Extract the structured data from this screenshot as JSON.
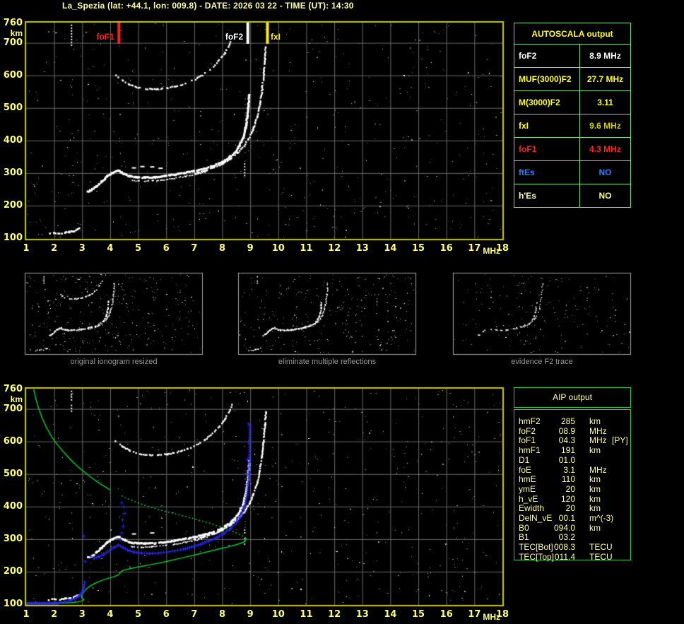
{
  "title": "La_Spezia (lat: +44.1, lon: 009.8) - DATE: 2026 03 22 - TIME (UT): 14:30",
  "colors": {
    "background": "#000000",
    "title_text": "#ffffa8",
    "axis_text": "#ffff7a",
    "plot_border": "#c9c900",
    "grid": "#6a6a6a",
    "echo_white": "#ffffff",
    "profile_green": "#00cc33",
    "restored_blue": "#2a2aff",
    "autoscala_border": "#7fe07f",
    "aip_border": "#2ecc44",
    "aip_text": "#ffffa2",
    "caption_gray": "#9a9a9a",
    "fof1_red": "#ff2020",
    "fof2_white": "#ffffff",
    "fxi_yellow": "#ffee00"
  },
  "ionogram": {
    "x_unit": "MHz",
    "y_unit": "km",
    "x_ticks": [
      "1",
      "2",
      "3",
      "4",
      "5",
      "6",
      "7",
      "8",
      "9",
      "10",
      "11",
      "12",
      "13",
      "14",
      "15",
      "16",
      "17",
      "18"
    ],
    "x_values": [
      1,
      2,
      3,
      4,
      5,
      6,
      7,
      8,
      9,
      10,
      11,
      12,
      13,
      14,
      15,
      16,
      17,
      18
    ],
    "y_ticks": [
      "760",
      "700",
      "600",
      "500",
      "400",
      "300",
      "200",
      "100"
    ],
    "y_values": [
      760,
      700,
      600,
      500,
      400,
      300,
      200,
      100
    ],
    "x_range": [
      1,
      18
    ],
    "y_range": [
      100,
      760
    ],
    "markers": [
      {
        "label": "foF1",
        "f": 4.3,
        "color": "#ff2020",
        "side": "left"
      },
      {
        "label": "foF2",
        "f": 8.9,
        "color": "#ffffff",
        "side": "left"
      },
      {
        "label": "fxI",
        "f": 9.6,
        "color": "#ffee00",
        "side": "right"
      }
    ]
  },
  "autoscala_table": {
    "header": "AUTOSCALA output",
    "header_color": "#ffff21",
    "rows": [
      {
        "label": "foF2",
        "value": "8.9 MHz",
        "label_color": "#ffffff",
        "value_color": "#ffffff"
      },
      {
        "label": "MUF(3000)F2",
        "value": "27.7 MHz",
        "label_color": "#ffff21",
        "value_color": "#ffff21"
      },
      {
        "label": "M(3000)F2",
        "value": "3.11",
        "label_color": "#ffff21",
        "value_color": "#ffff21"
      },
      {
        "label": "fxI",
        "value": "9.6 MHz",
        "label_color": "#ffff10",
        "value_color": "#cfcf00"
      },
      {
        "label": "foF1",
        "value": "4.3 MHz",
        "label_color": "#ff2020",
        "value_color": "#ff2020"
      },
      {
        "label": "ftEs",
        "value": "NO",
        "label_color": "#2e7fff",
        "value_color": "#2e7fff"
      },
      {
        "label": "h'Es",
        "value": "NO",
        "label_color": "#ffffb4",
        "value_color": "#ffff8c"
      }
    ]
  },
  "thumbnails": [
    {
      "caption": "original ionogram resized"
    },
    {
      "caption": "eliminate multiple reflections"
    },
    {
      "caption": "evidence F2 trace"
    }
  ],
  "aip_table": {
    "header": "AIP output",
    "rows": [
      {
        "label": "hmF2",
        "value": "285",
        "unit": "km",
        "extra": ""
      },
      {
        "label": "foF2",
        "value": "08.9",
        "unit": "MHz",
        "extra": ""
      },
      {
        "label": "foF1",
        "value": "04.3",
        "unit": "MHz",
        "extra": "[PY]"
      },
      {
        "label": "hmF1",
        "value": "191",
        "unit": "km",
        "extra": ""
      },
      {
        "label": "D1",
        "value": "01.0",
        "unit": "",
        "extra": ""
      },
      {
        "label": "foE",
        "value": "3.1",
        "unit": "MHz",
        "extra": ""
      },
      {
        "label": "hmE",
        "value": "110",
        "unit": "km",
        "extra": ""
      },
      {
        "label": "ymE",
        "value": "20",
        "unit": "km",
        "extra": ""
      },
      {
        "label": "h_vE",
        "value": "120",
        "unit": "km",
        "extra": ""
      },
      {
        "label": "Ewidth",
        "value": "20",
        "unit": "km",
        "extra": ""
      },
      {
        "label": "DelN_vE",
        "value": "00.1",
        "unit": "m^(-3)",
        "extra": ""
      },
      {
        "label": "B0",
        "value": "094.0",
        "unit": "km",
        "extra": ""
      },
      {
        "label": "B1",
        "value": "03.2",
        "unit": "",
        "extra": ""
      },
      {
        "label": "TEC[Bot]",
        "value": "008.3",
        "unit": "TECU",
        "extra": ""
      },
      {
        "label": "TEC[Top]",
        "value": "011.4",
        "unit": "TECU",
        "extra": ""
      }
    ]
  },
  "traces": {
    "o_trace": [
      [
        3.2,
        243
      ],
      [
        3.32,
        247
      ],
      [
        3.5,
        258
      ],
      [
        3.7,
        273
      ],
      [
        3.9,
        290
      ],
      [
        4.1,
        301
      ],
      [
        4.3,
        307
      ],
      [
        4.5,
        297
      ],
      [
        4.7,
        290
      ],
      [
        4.95,
        287
      ],
      [
        5.25,
        286
      ],
      [
        5.6,
        287
      ],
      [
        5.95,
        291
      ],
      [
        6.3,
        295
      ],
      [
        6.65,
        300
      ],
      [
        7.0,
        306
      ],
      [
        7.35,
        313
      ],
      [
        7.7,
        322
      ],
      [
        8.0,
        333
      ],
      [
        8.25,
        347
      ],
      [
        8.45,
        363
      ],
      [
        8.62,
        384
      ],
      [
        8.75,
        409
      ],
      [
        8.84,
        440
      ],
      [
        8.9,
        475
      ],
      [
        8.94,
        510
      ],
      [
        8.97,
        540
      ]
    ],
    "o_lower": [
      [
        4.75,
        277
      ],
      [
        5.1,
        275
      ],
      [
        5.5,
        276
      ],
      [
        5.9,
        279
      ],
      [
        6.3,
        284
      ],
      [
        6.7,
        290
      ],
      [
        7.1,
        297
      ],
      [
        7.45,
        305
      ]
    ],
    "x_trace": [
      [
        7.0,
        299
      ],
      [
        7.35,
        306
      ],
      [
        7.7,
        316
      ],
      [
        8.0,
        328
      ],
      [
        8.3,
        343
      ],
      [
        8.55,
        361
      ],
      [
        8.78,
        383
      ],
      [
        8.98,
        410
      ],
      [
        9.13,
        440
      ],
      [
        9.25,
        473
      ],
      [
        9.34,
        510
      ],
      [
        9.42,
        552
      ],
      [
        9.48,
        600
      ],
      [
        9.53,
        650
      ],
      [
        9.56,
        692
      ]
    ],
    "second_hop": [
      [
        4.2,
        600
      ],
      [
        4.45,
        584
      ],
      [
        4.7,
        571
      ],
      [
        5.0,
        563
      ],
      [
        5.35,
        558
      ],
      [
        5.7,
        558
      ],
      [
        6.05,
        561
      ],
      [
        6.4,
        567
      ],
      [
        6.75,
        577
      ],
      [
        7.1,
        590
      ],
      [
        7.4,
        606
      ],
      [
        7.65,
        624
      ],
      [
        7.9,
        646
      ],
      [
        8.1,
        668
      ],
      [
        8.25,
        692
      ],
      [
        8.35,
        712
      ]
    ],
    "e_trace": [
      [
        1.8,
        113
      ],
      [
        2.0,
        116
      ],
      [
        2.2,
        114
      ],
      [
        2.4,
        117
      ],
      [
        2.55,
        119
      ],
      [
        2.7,
        122
      ],
      [
        2.82,
        126
      ],
      [
        2.9,
        131
      ]
    ],
    "upper_dashes": [
      [
        4.85,
        318
      ],
      [
        5.15,
        322
      ],
      [
        5.5,
        321
      ],
      [
        5.8,
        317
      ]
    ],
    "streak": {
      "f": 2.62,
      "h1": 690,
      "h2": 756
    },
    "fof2_white_drop": {
      "f": 8.8,
      "h1": 283,
      "h2": 330
    },
    "fof2_gray_line": {
      "f": 8.82,
      "h1": 300,
      "h2": 530
    },
    "green_topside": [
      [
        1.27,
        760
      ],
      [
        1.35,
        730
      ],
      [
        1.45,
        700
      ],
      [
        1.58,
        670
      ],
      [
        1.72,
        644
      ],
      [
        1.9,
        616
      ],
      [
        2.1,
        592
      ],
      [
        2.35,
        566
      ],
      [
        2.62,
        541
      ],
      [
        2.92,
        517
      ],
      [
        3.25,
        494
      ],
      [
        3.6,
        472
      ],
      [
        4.0,
        451
      ],
      [
        4.4,
        433
      ],
      [
        4.85,
        416
      ],
      [
        5.3,
        402
      ],
      [
        5.8,
        389
      ],
      [
        6.3,
        378
      ],
      [
        6.8,
        367
      ],
      [
        7.3,
        355
      ],
      [
        7.8,
        342
      ],
      [
        8.2,
        330
      ],
      [
        8.5,
        319
      ],
      [
        8.72,
        310
      ],
      [
        8.87,
        302
      ]
    ],
    "green_solid_until": 4.3,
    "green_bottomside": [
      [
        8.87,
        302
      ],
      [
        8.78,
        291
      ],
      [
        8.5,
        283
      ],
      [
        8.1,
        274
      ],
      [
        7.6,
        264
      ],
      [
        7.1,
        253
      ],
      [
        6.6,
        243
      ],
      [
        6.1,
        233
      ],
      [
        5.6,
        224
      ],
      [
        5.1,
        216
      ],
      [
        4.7,
        209
      ],
      [
        4.45,
        204
      ],
      [
        4.35,
        197
      ],
      [
        4.3,
        191
      ],
      [
        4.15,
        185
      ],
      [
        3.95,
        180
      ],
      [
        3.7,
        173
      ],
      [
        3.45,
        164
      ],
      [
        3.25,
        154
      ],
      [
        3.1,
        143
      ],
      [
        3.02,
        133
      ],
      [
        2.97,
        124
      ],
      [
        3.0,
        118
      ],
      [
        3.06,
        114
      ],
      [
        2.98,
        110
      ],
      [
        2.85,
        107
      ],
      [
        2.65,
        105
      ],
      [
        2.4,
        104
      ],
      [
        2.1,
        104
      ],
      [
        1.8,
        103
      ],
      [
        1.4,
        103
      ],
      [
        1.03,
        103
      ]
    ],
    "blue_trace": [
      [
        3.3,
        247
      ],
      [
        3.42,
        243
      ],
      [
        3.58,
        247
      ],
      [
        3.75,
        254
      ],
      [
        3.95,
        265
      ],
      [
        4.12,
        275
      ],
      [
        4.28,
        283
      ],
      [
        4.45,
        275
      ],
      [
        4.62,
        267
      ],
      [
        4.85,
        261
      ],
      [
        5.1,
        258
      ],
      [
        5.4,
        257
      ],
      [
        5.7,
        258
      ],
      [
        6.0,
        261
      ],
      [
        6.3,
        265
      ],
      [
        6.6,
        270
      ],
      [
        6.9,
        277
      ],
      [
        7.2,
        285
      ],
      [
        7.5,
        295
      ],
      [
        7.8,
        306
      ],
      [
        8.05,
        319
      ],
      [
        8.3,
        335
      ],
      [
        8.5,
        354
      ],
      [
        8.68,
        378
      ],
      [
        8.8,
        405
      ],
      [
        8.87,
        437
      ],
      [
        8.91,
        472
      ],
      [
        8.94,
        510
      ],
      [
        8.96,
        552
      ],
      [
        8.97,
        600
      ],
      [
        8.98,
        650
      ]
    ],
    "blue_bottom": {
      "h": 103,
      "f1": 1.0,
      "f2": 2.12
    },
    "blue_rise": [
      [
        2.15,
        105
      ],
      [
        2.35,
        108
      ],
      [
        2.55,
        112
      ],
      [
        2.72,
        118
      ],
      [
        2.85,
        125
      ],
      [
        2.95,
        133
      ],
      [
        3.02,
        143
      ],
      [
        3.06,
        156
      ],
      [
        3.08,
        170
      ]
    ],
    "blue_scatter": [
      [
        4.35,
        300
      ],
      [
        4.4,
        320
      ],
      [
        4.45,
        340
      ],
      [
        4.43,
        360
      ],
      [
        4.5,
        380
      ],
      [
        4.47,
        400
      ],
      [
        4.4,
        412
      ],
      [
        3.05,
        310
      ],
      [
        3.1,
        232
      ],
      [
        8.93,
        655
      ],
      [
        8.9,
        545
      ],
      [
        8.92,
        600
      ],
      [
        8.88,
        500
      ]
    ],
    "noise_counts": {
      "top": 520,
      "bottom": 540,
      "thumbs": [
        300,
        270,
        170
      ]
    }
  }
}
